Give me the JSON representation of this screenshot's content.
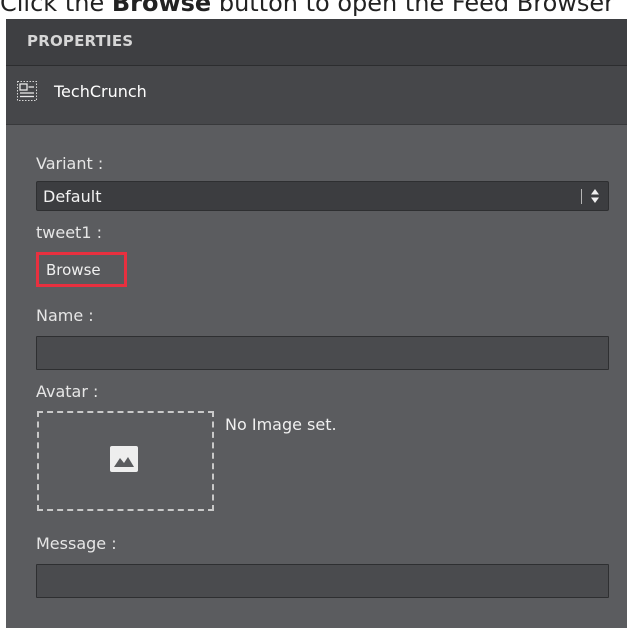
{
  "caption": {
    "prefix": "Click the ",
    "bold": "Browse",
    "suffix": " button to open the Feed Browser"
  },
  "panel": {
    "header": "PROPERTIES",
    "node_title": "TechCrunch",
    "node_icon": "node-icon"
  },
  "fields": {
    "variant_label": "Variant :",
    "variant_value": "Default",
    "tweet_label": "tweet1 :",
    "browse_label": "Browse",
    "name_label": "Name :",
    "name_value": "",
    "avatar_label": "Avatar :",
    "avatar_status": "No Image set.",
    "message_label": "Message :",
    "message_value": ""
  },
  "colors": {
    "highlight": "#e8303f",
    "panel_bg": "#5b5c5f",
    "header_bg": "#3e3f42"
  }
}
